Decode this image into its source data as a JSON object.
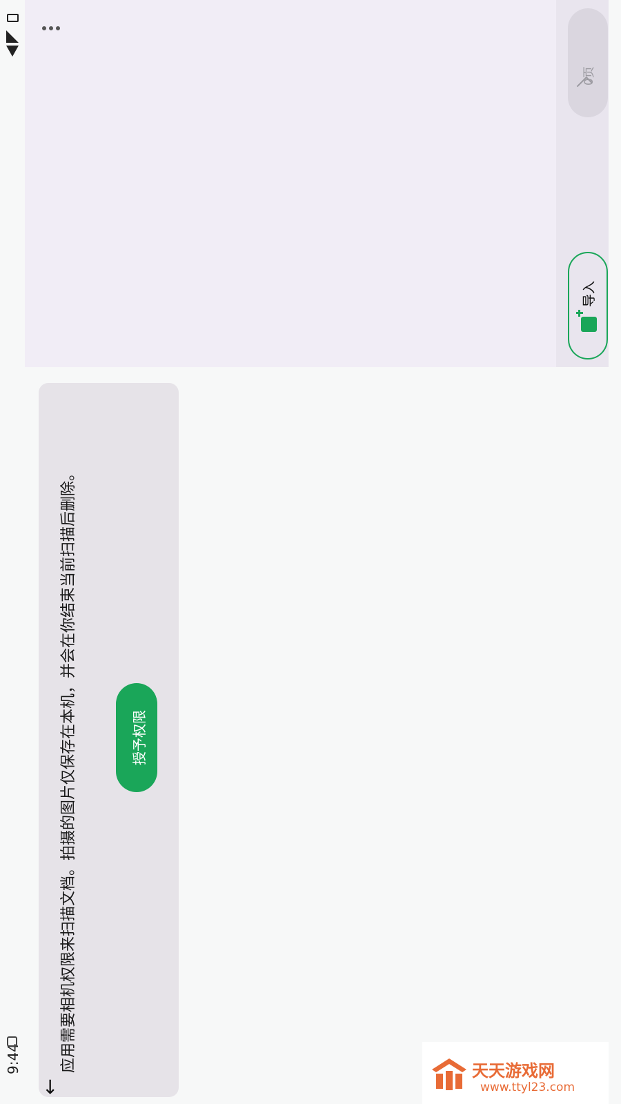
{
  "status_bar": {
    "time": "9:44",
    "icons": [
      "notification-icon",
      "wifi-icon",
      "signal-icon",
      "battery-icon"
    ]
  },
  "camera": {
    "more_icon": "more-horizontal-icon",
    "pages_label": "0页",
    "import_label": "导入"
  },
  "permission": {
    "message": "应用需要相机权限来扫描文档。拍摄的图片仅保存在本机，并会在你结束当前扫描后删除。",
    "grant_label": "授予权限",
    "arrow_icon": "arrow-back-icon"
  },
  "watermark": {
    "text": "天天游戏网",
    "url": "www.ttyl23.com"
  },
  "colors": {
    "accent": "#1aa659",
    "card_bg": "#e6e3e8",
    "camera_bg": "#f1edf6",
    "watermark": "#e86b36"
  }
}
